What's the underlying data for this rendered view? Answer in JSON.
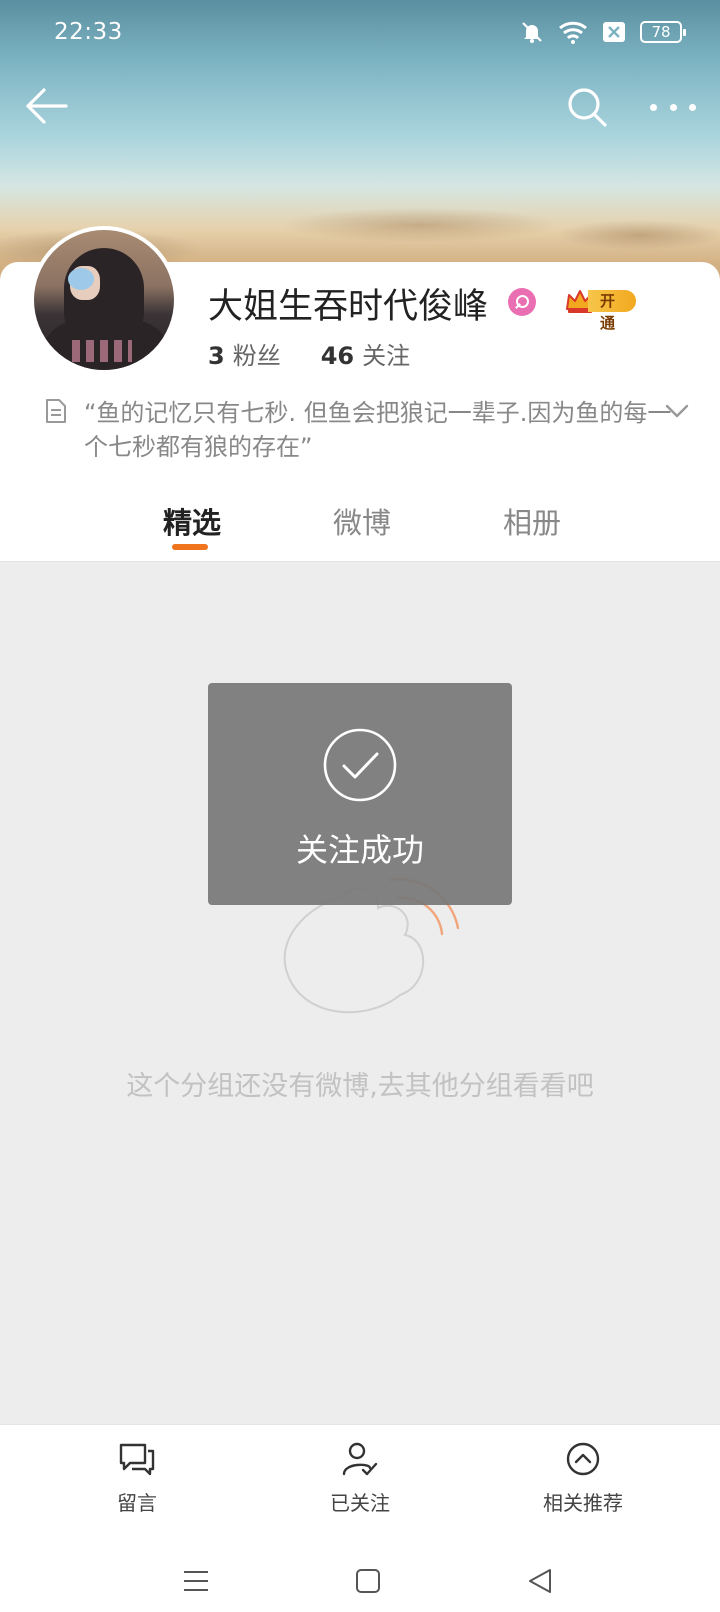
{
  "status_bar": {
    "time": "22:33",
    "battery": "78"
  },
  "profile": {
    "name": "大姐生吞时代俊峰",
    "vip_label": "开通",
    "fans_count": "3",
    "fans_label": "粉丝",
    "follow_count": "46",
    "follow_label": "关注",
    "bio": "“鱼的记忆只有七秒. 但鱼会把狼记一辈子.因为鱼的每一个七秒都有狼的存在”"
  },
  "tabs": [
    {
      "label": "精选",
      "active": true
    },
    {
      "label": "微博",
      "active": false
    },
    {
      "label": "相册",
      "active": false
    }
  ],
  "empty_state": {
    "message": "这个分组还没有微博,去其他分组看看吧"
  },
  "toast": {
    "message": "关注成功"
  },
  "actions": [
    {
      "label": "留言",
      "icon": "comment-icon"
    },
    {
      "label": "已关注",
      "icon": "user-check-icon"
    },
    {
      "label": "相关推荐",
      "icon": "chevron-up-circle-icon"
    }
  ],
  "colors": {
    "accent": "#f0731e",
    "vip_pink": "#ea6fb2",
    "toast_bg": "#787878"
  }
}
